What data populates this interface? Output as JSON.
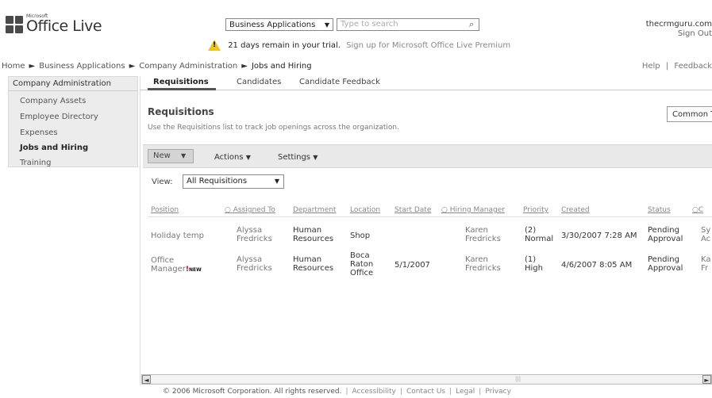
{
  "header": {
    "brand_small": "Microsoft",
    "brand_name": "Office Live",
    "scope": "Business Applications",
    "search_placeholder": "Type to search",
    "account_name": "thecrmguru.com",
    "sign_out": "Sign Out",
    "trial_text": "21 days remain in your trial.",
    "trial_link": "Sign up for Microsoft Office Live Premium",
    "help": "Help",
    "feedback": "Feedback"
  },
  "breadcrumb": [
    "Home",
    "Business Applications",
    "Company Administration",
    "Jobs and Hiring"
  ],
  "sidebar": {
    "header": "Company Administration",
    "items": [
      "Company Assets",
      "Employee Directory",
      "Expenses",
      "Jobs and Hiring",
      "Training"
    ]
  },
  "tabs": [
    "Requisitions",
    "Candidates",
    "Candidate Feedback"
  ],
  "main": {
    "title": "Requisitions",
    "description": "Use the Requisitions list to track job openings across the organization.",
    "common_tasks": "Common T"
  },
  "toolbar": {
    "new": "New",
    "actions": "Actions",
    "settings": "Settings"
  },
  "view": {
    "label": "View:",
    "selected": "All Requisitions"
  },
  "table": {
    "columns": [
      "Position",
      "Assigned To",
      "Department",
      "Location",
      "Start Date",
      "Hiring Manager",
      "Priority",
      "Created",
      "Status",
      "C"
    ],
    "rows": [
      {
        "position": "Holiday temp",
        "assigned_to": "Alyssa Fredricks",
        "department": "Human Resources",
        "location": "Shop",
        "start_date": "",
        "hiring_manager": "Karen Fredricks",
        "priority": "(2) Normal",
        "created": "3/30/2007 7:28 AM",
        "status": "Pending Approval",
        "extra": "Sy Ac"
      },
      {
        "position": "Office Manager",
        "new_mark": "!",
        "new_label": "NEW",
        "assigned_to": "Alyssa Fredricks",
        "department": "Human Resources",
        "location": "Boca Raton Office",
        "start_date": "5/1/2007",
        "hiring_manager": "Karen Fredricks",
        "priority": "(1) High",
        "created": "4/6/2007 8:05 AM",
        "status": "Pending Approval",
        "extra": "Ka Fr"
      }
    ]
  },
  "footer": {
    "copyright": "© 2006 Microsoft Corporation. All rights reserved.",
    "links": [
      "Accessibility",
      "Contact Us",
      "Legal",
      "Privacy"
    ]
  }
}
